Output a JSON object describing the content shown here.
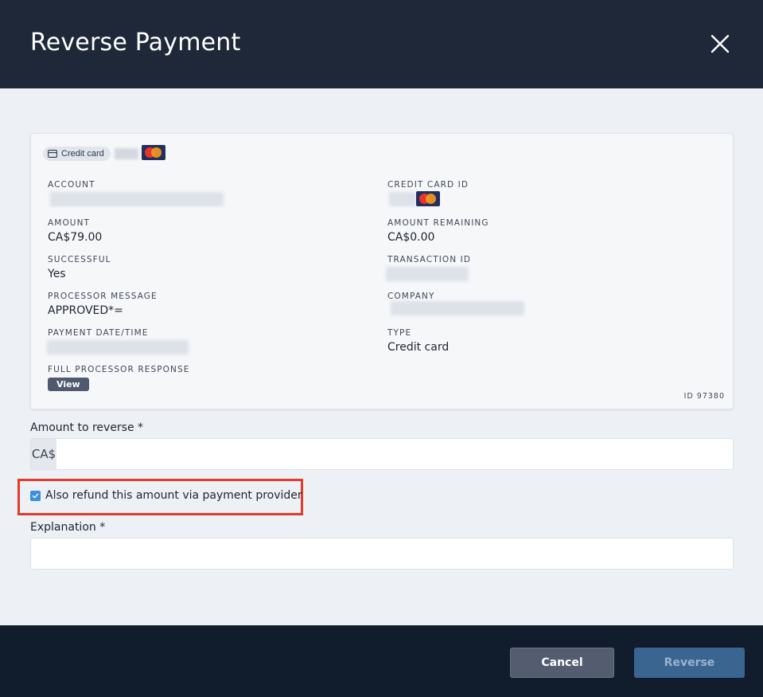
{
  "modal": {
    "title": "Reverse Payment"
  },
  "card": {
    "chip_label": "Credit card",
    "fields_left": [
      {
        "label": "ACCOUNT",
        "value": ""
      },
      {
        "label": "AMOUNT",
        "value": "CA$79.00"
      },
      {
        "label": "SUCCESSFUL",
        "value": "Yes"
      },
      {
        "label": "PROCESSOR MESSAGE",
        "value": "APPROVED*="
      },
      {
        "label": "PAYMENT DATE/TIME",
        "value": ""
      },
      {
        "label": "FULL PROCESSOR RESPONSE",
        "value": ""
      }
    ],
    "fields_right": [
      {
        "label": "CREDIT CARD ID",
        "value": ""
      },
      {
        "label": "AMOUNT REMAINING",
        "value": "CA$0.00"
      },
      {
        "label": "TRANSACTION ID",
        "value": ""
      },
      {
        "label": "COMPANY",
        "value": ""
      },
      {
        "label": "TYPE",
        "value": "Credit card"
      }
    ],
    "view_button": "View",
    "id_text": "ID 97380"
  },
  "form": {
    "amount_label": "Amount to reverse *",
    "amount_prefix": "CA$",
    "amount_value": "",
    "refund_checkbox_label": "Also refund this amount via payment provider",
    "refund_checked": true,
    "explanation_label": "Explanation *",
    "explanation_value": ""
  },
  "footer": {
    "cancel_label": "Cancel",
    "reverse_label": "Reverse"
  },
  "colors": {
    "header_bg": "#1e2838",
    "footer_bg": "#111c2c",
    "highlight": "#e23a2c",
    "checkbox": "#3c8ee0"
  }
}
